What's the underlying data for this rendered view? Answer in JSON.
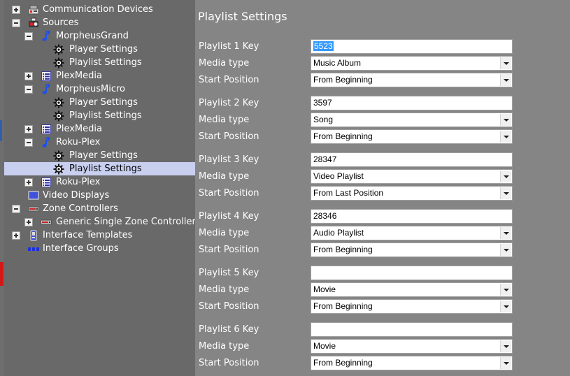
{
  "tree": {
    "items": [
      {
        "label": "Communication Devices",
        "icon": "communication-devices-icon",
        "expander": "plus"
      },
      {
        "label": "Sources",
        "icon": "sources-icon",
        "expander": "minus"
      },
      {
        "label": "MorpheusGrand",
        "icon": "music-note-icon",
        "expander": "minus"
      },
      {
        "label": "Player Settings",
        "icon": "gear-icon",
        "expander": ""
      },
      {
        "label": "Playlist Settings",
        "icon": "gear-icon",
        "expander": ""
      },
      {
        "label": "PlexMedia",
        "icon": "list-icon",
        "expander": "plus"
      },
      {
        "label": "MorpheusMicro",
        "icon": "music-note-icon",
        "expander": "minus"
      },
      {
        "label": "Player Settings",
        "icon": "gear-icon",
        "expander": ""
      },
      {
        "label": "Playlist Settings",
        "icon": "gear-icon",
        "expander": ""
      },
      {
        "label": "PlexMedia",
        "icon": "list-icon",
        "expander": "plus"
      },
      {
        "label": "Roku-Plex",
        "icon": "music-note-icon",
        "expander": "minus"
      },
      {
        "label": "Player Settings",
        "icon": "gear-icon",
        "expander": ""
      },
      {
        "label": "Playlist Settings",
        "icon": "gear-icon",
        "expander": "",
        "selected": true
      },
      {
        "label": "Roku-Plex",
        "icon": "list-icon",
        "expander": "plus"
      },
      {
        "label": "Video Displays",
        "icon": "display-icon",
        "expander": ""
      },
      {
        "label": "Zone Controllers",
        "icon": "zone-controller-icon",
        "expander": "minus"
      },
      {
        "label": "Generic Single Zone Controller",
        "icon": "zone-controller-icon",
        "expander": "plus"
      },
      {
        "label": "Interface Templates",
        "icon": "interface-template-icon",
        "expander": "plus"
      },
      {
        "label": "Interface Groups",
        "icon": "interface-groups-icon",
        "expander": ""
      }
    ]
  },
  "settings": {
    "title": "Playlist Settings",
    "labels": {
      "key_suffix": "Key",
      "media_type": "Media type",
      "start_position": "Start Position"
    },
    "playlists": [
      {
        "key_label": "Playlist 1 Key",
        "key": "5523",
        "key_selected": true,
        "media_type": "Music Album",
        "start_position": "From Beginning"
      },
      {
        "key_label": "Playlist 2 Key",
        "key": "3597",
        "media_type": "Song",
        "start_position": "From Beginning"
      },
      {
        "key_label": "Playlist 3 Key",
        "key": "28347",
        "media_type": "Video Playlist",
        "start_position": "From Last Position"
      },
      {
        "key_label": "Playlist 4 Key",
        "key": "28346",
        "media_type": "Audio Playlist",
        "start_position": "From Beginning"
      },
      {
        "key_label": "Playlist 5 Key",
        "key": "",
        "media_type": "Movie",
        "start_position": "From Beginning"
      },
      {
        "key_label": "Playlist 6 Key",
        "key": "",
        "media_type": "Movie",
        "start_position": "From Beginning"
      }
    ]
  },
  "colors": {
    "tree_bg": "#696969",
    "panel_bg": "#858585",
    "selected_row": "#c9cfef",
    "text_selection": "#3399ff"
  }
}
